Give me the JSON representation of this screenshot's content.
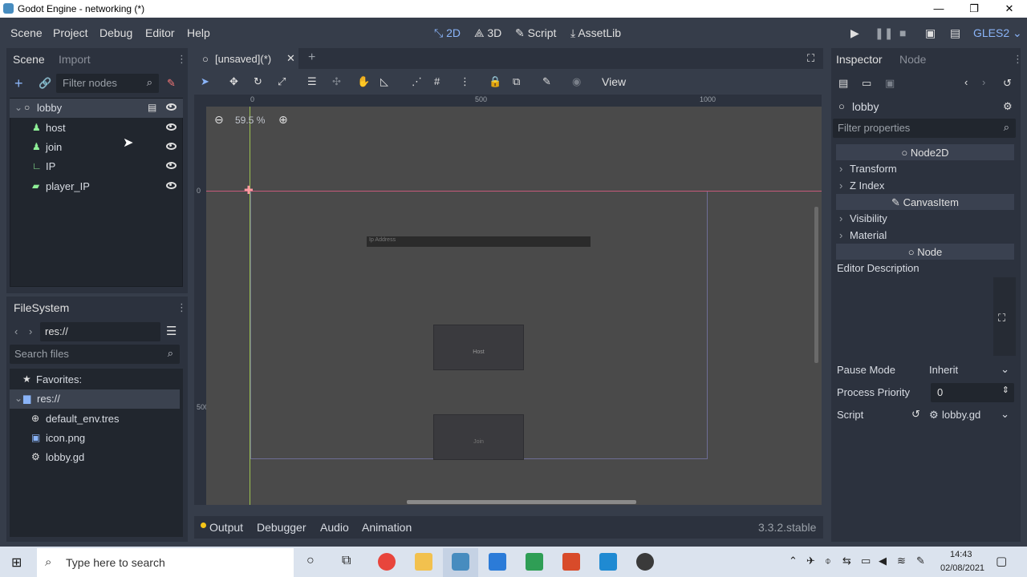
{
  "window": {
    "title": "Godot Engine - networking (*)",
    "minimize": "—",
    "maximize": "❐",
    "close": "✕"
  },
  "menu": {
    "items": [
      "Scene",
      "Project",
      "Debug",
      "Editor",
      "Help"
    ]
  },
  "workspaces": {
    "items": [
      "2D",
      "3D",
      "Script",
      "AssetLib"
    ],
    "active": "2D"
  },
  "renderer": "GLES2",
  "scene_dock": {
    "tabs": [
      "Scene",
      "Import"
    ],
    "filter_placeholder": "Filter nodes",
    "nodes": [
      {
        "label": "lobby",
        "icon": "node2d-icon"
      },
      {
        "label": "host",
        "icon": "button-icon"
      },
      {
        "label": "join",
        "icon": "button-icon"
      },
      {
        "label": "IP",
        "icon": "label-icon"
      },
      {
        "label": "player_IP",
        "icon": "lineedit-icon"
      }
    ]
  },
  "filesystem": {
    "title": "FileSystem",
    "path": "res://",
    "search_placeholder": "Search files",
    "favorites_label": "Favorites:",
    "items": [
      {
        "label": "res://",
        "icon": "folder-icon"
      },
      {
        "label": "default_env.tres",
        "icon": "environment-icon"
      },
      {
        "label": "icon.png",
        "icon": "image-icon"
      },
      {
        "label": "lobby.gd",
        "icon": "gear-icon"
      }
    ]
  },
  "editor": {
    "tab_label": "[unsaved](*)",
    "toolbar_view": "View",
    "zoom": "59.5 %",
    "ruler_marks": [
      "0",
      "500",
      "1000"
    ],
    "ruler_v_marks": [
      "0",
      "500"
    ],
    "canvas": {
      "ip_address_placeholder": "Ip Address",
      "host_label": "Host",
      "join_label": "Join"
    }
  },
  "bottom_panel": {
    "tabs": [
      "Output",
      "Debugger",
      "Audio",
      "Animation"
    ],
    "version": "3.3.2.stable"
  },
  "inspector": {
    "tabs": [
      "Inspector",
      "Node"
    ],
    "object_name": "lobby",
    "filter_placeholder": "Filter properties",
    "sections": [
      {
        "header": "Node2D",
        "items": [
          "Transform",
          "Z Index"
        ]
      },
      {
        "header": "CanvasItem",
        "items": [
          "Visibility",
          "Material"
        ]
      },
      {
        "header": "Node",
        "items": []
      }
    ],
    "editor_description_label": "Editor Description",
    "pause_mode": {
      "label": "Pause Mode",
      "value": "Inherit"
    },
    "process_priority": {
      "label": "Process Priority",
      "value": "0"
    },
    "script": {
      "label": "Script",
      "value": "lobby.gd"
    }
  },
  "taskbar": {
    "search_placeholder": "Type here to search",
    "time": "14:43",
    "date": "02/08/2021"
  }
}
